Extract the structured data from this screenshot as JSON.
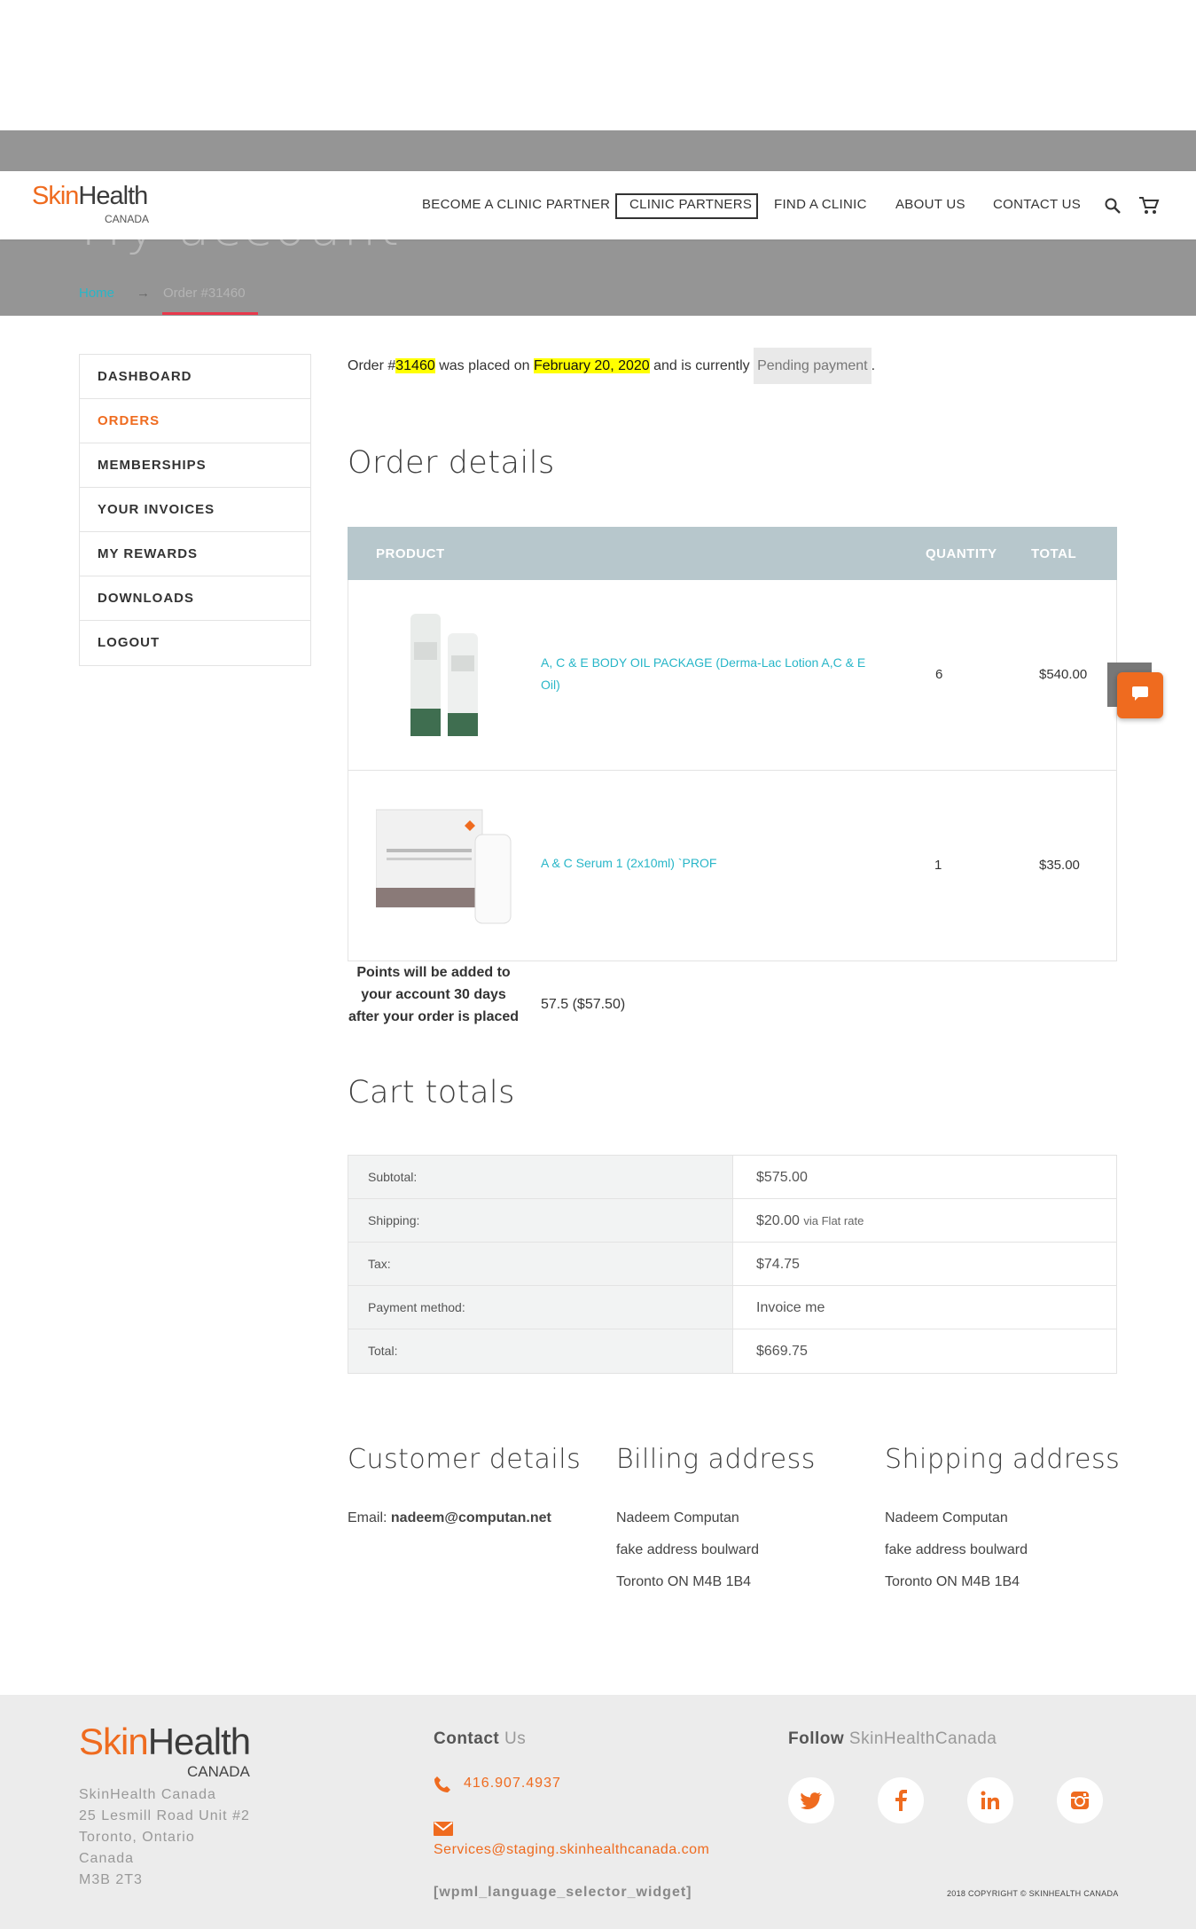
{
  "page": {
    "title": "My account",
    "breadcrumb": {
      "home": "Home",
      "arrow": "→",
      "current": "Order #31460"
    }
  },
  "header": {
    "logo": {
      "skin": "Skin",
      "health": "Health",
      "canada": "CANADA"
    },
    "nav": [
      "BECOME A CLINIC PARTNER",
      "CLINIC PARTNERS",
      "FIND A CLINIC",
      "ABOUT US",
      "CONTACT US"
    ],
    "icons": [
      "search-icon",
      "cart-icon"
    ]
  },
  "sidebar": {
    "items": [
      "DASHBOARD",
      "ORDERS",
      "MEMBERSHIPS",
      "YOUR INVOICES",
      "MY REWARDS",
      "DOWNLOADS",
      "LOGOUT"
    ],
    "active": "ORDERS"
  },
  "order": {
    "msg_prefix": "Order #",
    "number": "31460",
    "msg_placed": " was placed on ",
    "date": "February 20, 2020",
    "msg_status": " and is currently ",
    "status": "Pending payment",
    "msg_end": "."
  },
  "details": {
    "heading": "Order details",
    "columns": {
      "product": "PRODUCT",
      "quantity": "QUANTITY",
      "total": "TOTAL"
    },
    "items": [
      {
        "name": "A, C & E BODY OIL PACKAGE (Derma-Lac Lotion A,C & E Oil)",
        "quantity": "6",
        "total": "$540.00"
      },
      {
        "name": "A & C Serum 1 (2x10ml) `PROF",
        "quantity": "1",
        "total": "$35.00"
      }
    ],
    "points_label": "Points will be added to your account 30 days after your order is placed",
    "points_value": "57.5 ($57.50)"
  },
  "cart_totals": {
    "heading": "Cart totals",
    "rows": [
      {
        "label": "Subtotal:",
        "value": "$575.00",
        "note": ""
      },
      {
        "label": "Shipping:",
        "value": "$20.00",
        "note": "via Flat rate"
      },
      {
        "label": "Tax:",
        "value": "$74.75",
        "note": ""
      },
      {
        "label": "Payment method:",
        "value": "Invoice me",
        "note": ""
      },
      {
        "label": "Total:",
        "value": "$669.75",
        "note": ""
      }
    ]
  },
  "customer": {
    "heading": "Customer details",
    "email_label": "Email:",
    "email": "nadeem@computan.net"
  },
  "billing": {
    "heading": "Billing address",
    "lines": [
      "Nadeem Computan",
      "fake address boulward",
      "Toronto ON  M4B 1B4"
    ]
  },
  "shipping": {
    "heading": "Shipping address",
    "lines": [
      "Nadeem Computan",
      "fake address boulward",
      "Toronto ON  M4B 1B4"
    ]
  },
  "footer": {
    "logo": {
      "skin": "Skin",
      "health": "Health",
      "canada": "CANADA"
    },
    "address": [
      "SkinHealth Canada",
      "25 Lesmill Road Unit #2",
      "Toronto, Ontario",
      "Canada",
      "M3B 2T3"
    ],
    "contact_bold": "Contact",
    "contact_light": " Us",
    "phone": "416.907.4937",
    "email": "Services@staging.skinhealthcanada.com",
    "widget": "[wpml_language_selector_widget]",
    "follow_bold": "Follow",
    "follow_light": " SkinHealthCanada",
    "social": [
      "twitter-icon",
      "facebook-icon",
      "linkedin-icon",
      "instagram-icon"
    ],
    "copyright": "2018 COPYRIGHT © SKINHEALTH CANADA"
  },
  "colors": {
    "brand": "#ef6b1f",
    "link": "#28b6c8",
    "table_header": "#b7c7cc"
  }
}
